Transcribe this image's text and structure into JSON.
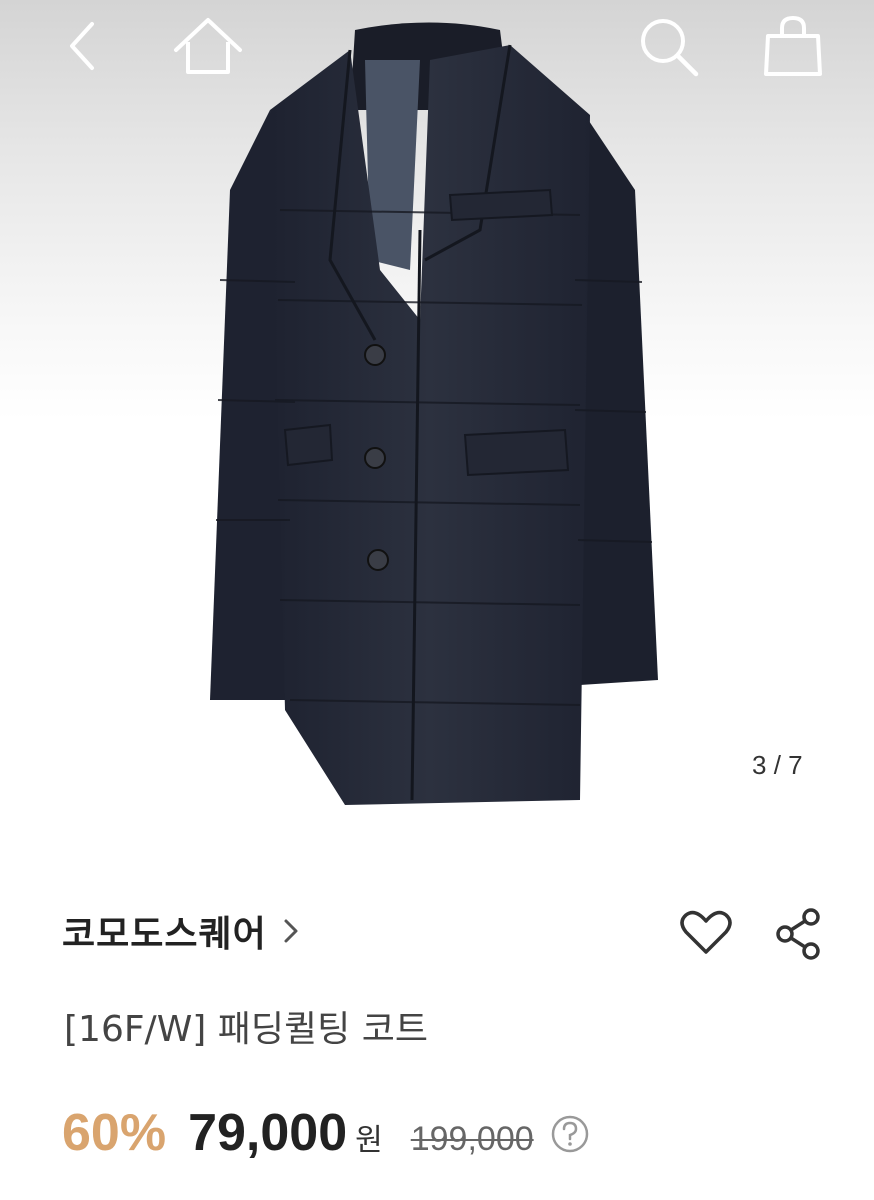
{
  "nav": {
    "back_icon": "chevron-left-icon",
    "home_icon": "home-icon",
    "search_icon": "search-icon",
    "bag_icon": "shopping-bag-icon"
  },
  "gallery": {
    "current": "3",
    "separator": " / ",
    "total": "7"
  },
  "product": {
    "brand": "코모도스퀘어",
    "title": "[16F/W] 패딩퀼팅 코트",
    "discount": "60%",
    "price": "79,000",
    "currency": "원",
    "original_price": "199,000"
  },
  "colors": {
    "discount": "#d9a46e",
    "text": "#222222",
    "muted": "#666666"
  }
}
